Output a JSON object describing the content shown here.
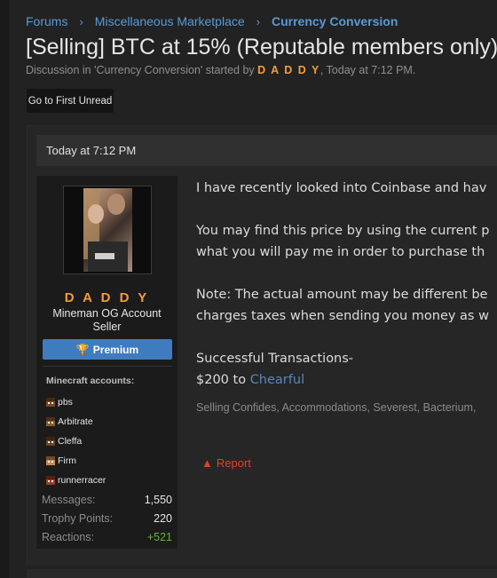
{
  "breadcrumb": {
    "items": [
      "Forums",
      "Miscellaneous Marketplace",
      "Currency Conversion"
    ],
    "separator": "›"
  },
  "thread": {
    "title": "[Selling] BTC at 15% (Reputable members only)",
    "meta_prefix": "Discussion in 'Currency Conversion' started by ",
    "author": "D A D D Y",
    "meta_suffix": ", Today at 7:12 PM."
  },
  "buttons": {
    "first_unread": "Go to First Unread"
  },
  "post": {
    "date": "Today at 7:12 PM",
    "user": {
      "name": "D A D D Y",
      "title": "Mineman OG Account Seller",
      "badge": "Premium",
      "minecraft_heading": "Minecraft accounts:",
      "minecraft_accounts": [
        {
          "name": "pbs",
          "color": "#7a4a22"
        },
        {
          "name": "Arbitrate",
          "color": "#8a5a30"
        },
        {
          "name": "Cleffa",
          "color": "#6b4424"
        },
        {
          "name": "Firm",
          "color": "#c88a50"
        },
        {
          "name": "runnerracer",
          "color": "#a03a2a"
        }
      ],
      "stats": [
        {
          "label": "Messages:",
          "value": "1,550"
        },
        {
          "label": "Trophy Points:",
          "value": "220"
        },
        {
          "label": "Reactions:",
          "value": "+521"
        }
      ]
    },
    "message": {
      "line1": "I have recently looked into Coinbase and hav",
      "line2": "You may find this price by using the current p",
      "line3": "what you will pay me in order to purchase th",
      "line4": "Note: The actual amount may be different be",
      "line5": "charges taxes when sending you money as w",
      "line6": "Successful Transactions-",
      "line7_prefix": "$200 to ",
      "line7_link": "Chearful"
    },
    "tags": "Selling Confides, Accommodations, Severest, Bacterium,",
    "report": "Report"
  },
  "colors": {
    "accent_blue": "#5a99d4",
    "author_orange": "#f39c3d",
    "premium_blue": "#3e7cbf",
    "report_red": "#e0412b",
    "reactions_green": "#63b047"
  }
}
